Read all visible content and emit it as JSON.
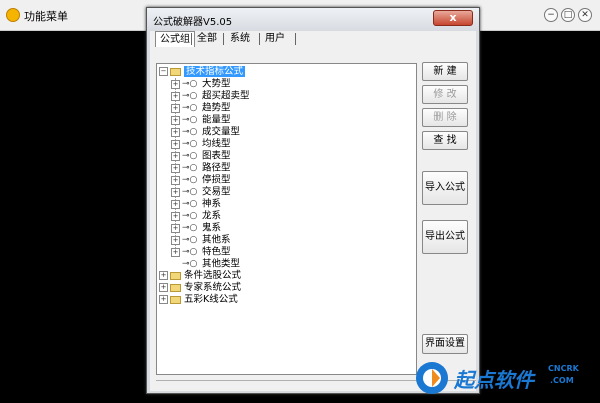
{
  "background_window": {
    "title": "功能菜单",
    "buttons": [
      "−",
      "□",
      "✕"
    ]
  },
  "dialog": {
    "title": "公式破解器V5.05",
    "close_label": "x"
  },
  "tabs": [
    "公式组",
    "全部",
    "系统",
    "用户"
  ],
  "tree": {
    "root": "技术指标公式",
    "children": [
      "大势型",
      "超买超卖型",
      "趋势型",
      "能量型",
      "成交量型",
      "均线型",
      "图表型",
      "路径型",
      "停损型",
      "交易型",
      "神系",
      "龙系",
      "鬼系",
      "其他系",
      "特色型",
      "其他类型"
    ],
    "top_level": [
      "条件选股公式",
      "专家系统公式",
      "五彩K线公式"
    ]
  },
  "buttons": {
    "new": "新 建",
    "edit": "修 改",
    "delete": "删 除",
    "find": "查 找",
    "import": "导入公式",
    "export": "导出公式",
    "ui_settings": "界面设置"
  },
  "watermark": {
    "text": "起点软件",
    "sub1": "CNCRK",
    "sub2": ".COM"
  },
  "colors": {
    "selection": "#3399ff",
    "watermark_blue": "#1a78d2",
    "watermark_orange": "#f08c1e"
  }
}
